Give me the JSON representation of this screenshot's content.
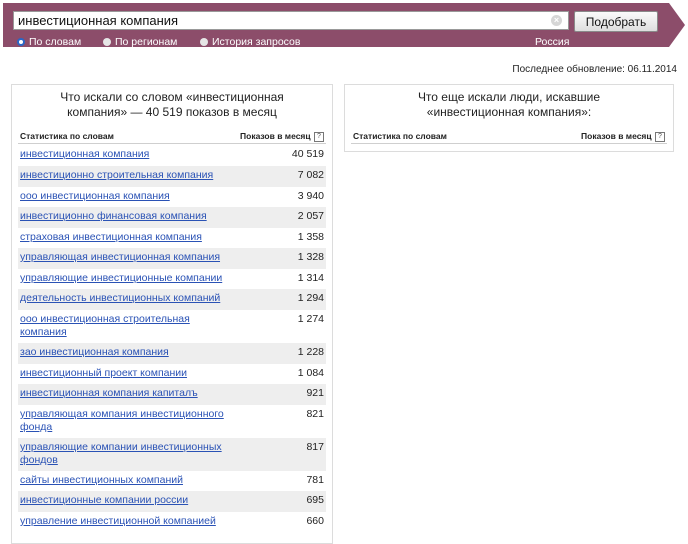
{
  "search": {
    "value": "инвестиционная компания",
    "clear_symbol": "×",
    "submit_label": "Подобрать"
  },
  "tabs": [
    {
      "label": "По словам",
      "selected": true
    },
    {
      "label": "По регионам",
      "selected": false
    },
    {
      "label": "История запросов",
      "selected": false
    }
  ],
  "region": "Россия",
  "last_update": "Последнее обновление: 06.11.2014",
  "left_panel": {
    "title_line1": "Что искали со словом «инвестиционная",
    "title_line2": "компания» — 40 519 показов в месяц",
    "col_keywords": "Статистика по словам",
    "col_count": "Показов в месяц",
    "help_symbol": "?",
    "rows": [
      {
        "keyword": "инвестиционная компания",
        "count": "40 519"
      },
      {
        "keyword": "инвестиционно строительная компания",
        "count": "7 082"
      },
      {
        "keyword": "ооо инвестиционная компания",
        "count": "3 940"
      },
      {
        "keyword": "инвестиционно финансовая компания",
        "count": "2 057"
      },
      {
        "keyword": "страховая инвестиционная компания",
        "count": "1 358"
      },
      {
        "keyword": "управляющая инвестиционная компания",
        "count": "1 328"
      },
      {
        "keyword": "управляющие инвестиционные компании",
        "count": "1 314"
      },
      {
        "keyword": "деятельность инвестиционных компаний",
        "count": "1 294"
      },
      {
        "keyword": "ооо инвестиционная строительная компания",
        "count": "1 274"
      },
      {
        "keyword": "зао инвестиционная компания",
        "count": "1 228"
      },
      {
        "keyword": "инвестиционный проект компании",
        "count": "1 084"
      },
      {
        "keyword": "инвестиционная компания капиталъ",
        "count": "921"
      },
      {
        "keyword": "управляющая компания инвестиционного фонда",
        "count": "821"
      },
      {
        "keyword": "управляющие компании инвестиционных фондов",
        "count": "817"
      },
      {
        "keyword": "сайты инвестиционных компаний",
        "count": "781"
      },
      {
        "keyword": "инвестиционные компании россии",
        "count": "695"
      },
      {
        "keyword": "управление инвестиционной компанией",
        "count": "660"
      }
    ]
  },
  "right_panel": {
    "title_line1": "Что еще искали люди, искавшие",
    "title_line2": "«инвестиционная компания»:",
    "col_keywords": "Статистика по словам",
    "col_count": "Показов в месяц",
    "help_symbol": "?"
  },
  "colors": {
    "header_bar": "#8c4d6a",
    "link": "#2a52b5",
    "row_alt": "#eeeeee"
  }
}
